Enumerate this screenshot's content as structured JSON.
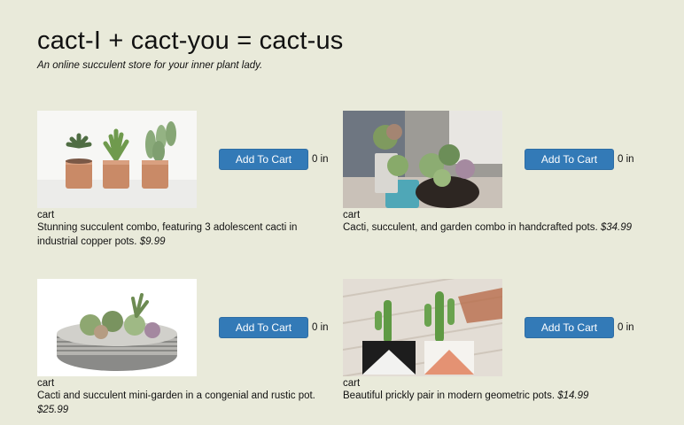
{
  "header": {
    "title": "cact-I + cact-you = cact-us",
    "tagline": "An online succulent store for your inner plant lady."
  },
  "products": [
    {
      "button_label": "Add To Cart",
      "count_label": "0 in",
      "cart_label": "cart",
      "description": "Stunning succulent combo, featuring 3 adolescent cacti in industrial copper pots. ",
      "price": "$9.99"
    },
    {
      "button_label": "Add To Cart",
      "count_label": "0 in",
      "cart_label": "cart",
      "description": "Cacti, succulent, and garden combo in handcrafted pots. ",
      "price": "$34.99"
    },
    {
      "button_label": "Add To Cart",
      "count_label": "0 in",
      "cart_label": "cart",
      "description": "Cacti and succulent mini-garden in a congenial and rustic pot. ",
      "price": "$25.99"
    },
    {
      "button_label": "Add To Cart",
      "count_label": "0 in",
      "cart_label": "cart",
      "description": "Beautiful prickly pair in modern geometric pots. ",
      "price": "$14.99"
    }
  ],
  "theme": {
    "background": "#e9eada",
    "button": "#337ab7"
  }
}
